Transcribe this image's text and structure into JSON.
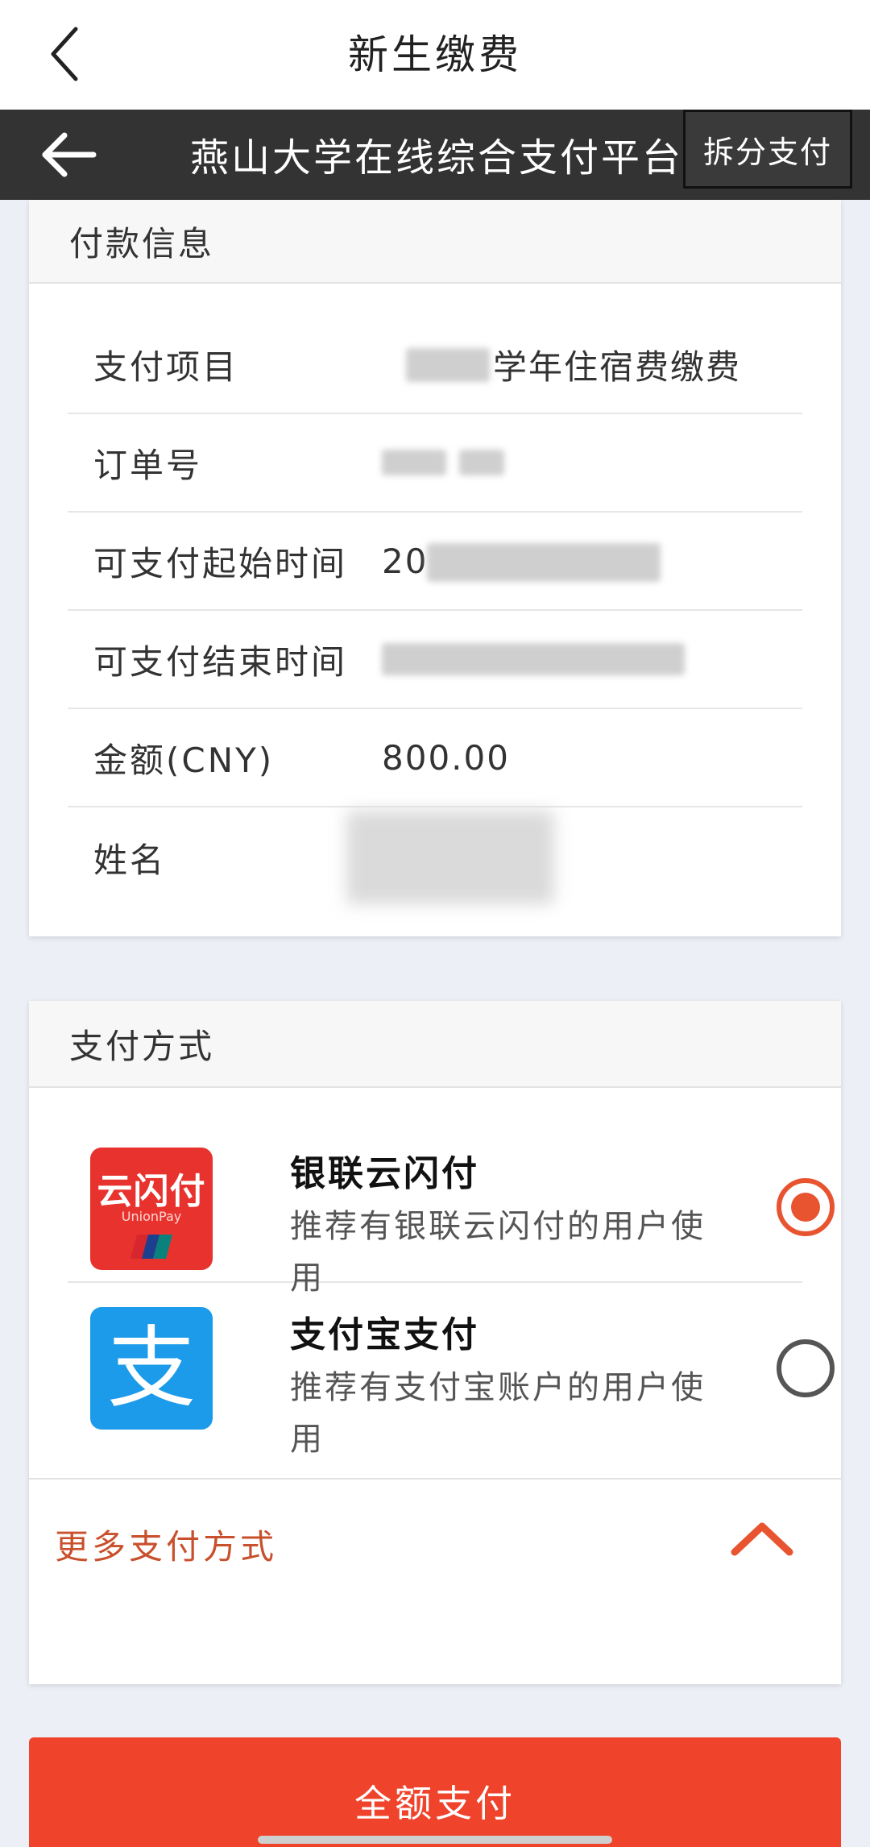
{
  "top_bar": {
    "title": "新生缴费"
  },
  "platform_bar": {
    "title": "燕山大学在线综合支付平台",
    "split_button": "拆分支付"
  },
  "payment_info": {
    "header": "付款信息",
    "rows": [
      {
        "label": "支付项目",
        "value": "学年住宿费缴费"
      },
      {
        "label": "订单号",
        "value": ""
      },
      {
        "label": "可支付起始时间",
        "value": "20"
      },
      {
        "label": "可支付结束时间",
        "value": ""
      },
      {
        "label": "金额(CNY)",
        "value": "800.00"
      },
      {
        "label": "姓名",
        "value": ""
      }
    ]
  },
  "payment_method": {
    "header": "支付方式",
    "options": [
      {
        "name": "银联云闪付",
        "desc": "推荐有银联云闪付的用户使用",
        "logo_text": "云闪付",
        "logo_sub": "UnionPay",
        "selected": true
      },
      {
        "name": "支付宝支付",
        "desc": "推荐有支付宝账户的用户使用",
        "logo_text": "支",
        "selected": false
      }
    ],
    "more_label": "更多支付方式"
  },
  "footer": {
    "pay_button": "全额支付"
  },
  "colors": {
    "accent": "#e8542f",
    "pay_button": "#f0432b",
    "dark_bar": "#333333",
    "unionpay_red": "#e8322e",
    "alipay_blue": "#1b9bea"
  }
}
